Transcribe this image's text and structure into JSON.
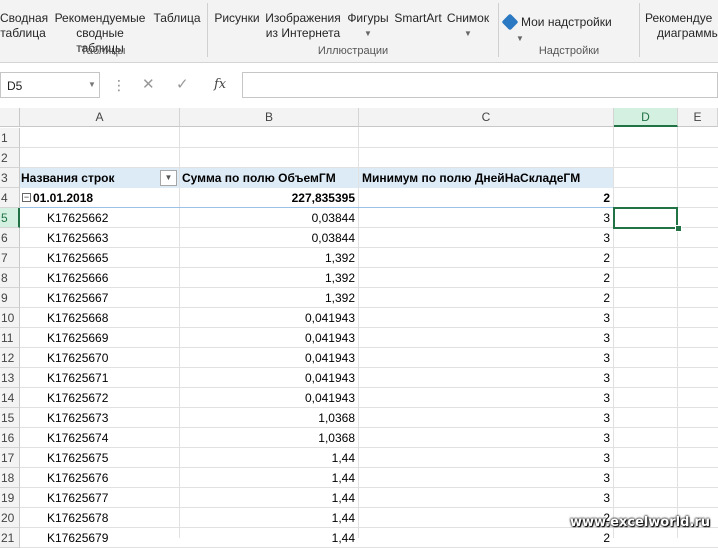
{
  "ribbon": {
    "groups": [
      {
        "label": "Таблицы",
        "buttons": [
          {
            "line1": "Сводная",
            "line2": "таблица"
          },
          {
            "line1": "Рекомендуемые",
            "line2": "сводные таблицы"
          },
          {
            "line1": "Таблица",
            "line2": ""
          }
        ]
      },
      {
        "label": "Иллюстрации",
        "buttons": [
          {
            "line1": "Рисунки",
            "line2": ""
          },
          {
            "line1": "Изображения",
            "line2": "из Интернета"
          },
          {
            "line1": "Фигуры",
            "line2": ""
          },
          {
            "line1": "SmartArt",
            "line2": ""
          },
          {
            "line1": "Снимок",
            "line2": ""
          }
        ]
      },
      {
        "label": "Надстройки",
        "buttons": [
          {
            "line1": "Мои надстройки",
            "line2": ""
          }
        ]
      },
      {
        "label": "",
        "buttons": [
          {
            "line1": "Рекомендуе",
            "line2": "диаграммы"
          }
        ]
      }
    ]
  },
  "formula_bar": {
    "name_box": "D5",
    "value": ""
  },
  "columns": [
    "A",
    "B",
    "C",
    "D",
    "E"
  ],
  "rows": [
    "1",
    "2",
    "3",
    "4",
    "5",
    "6",
    "7",
    "8",
    "9",
    "10",
    "11",
    "12",
    "13",
    "14",
    "15",
    "16",
    "17",
    "18",
    "19",
    "20",
    "21"
  ],
  "pivot": {
    "headers": [
      "Названия строк",
      "Сумма по полю ОбъемГМ",
      "Минимум по полю ДнейНаСкладеГМ"
    ],
    "group": {
      "label": "01.01.2018",
      "sum": "227,835395",
      "min": "2"
    },
    "items": [
      {
        "name": "K17625662",
        "sum": "0,03844",
        "min": "3"
      },
      {
        "name": "K17625663",
        "sum": "0,03844",
        "min": "3"
      },
      {
        "name": "K17625665",
        "sum": "1,392",
        "min": "2"
      },
      {
        "name": "K17625666",
        "sum": "1,392",
        "min": "2"
      },
      {
        "name": "K17625667",
        "sum": "1,392",
        "min": "2"
      },
      {
        "name": "K17625668",
        "sum": "0,041943",
        "min": "3"
      },
      {
        "name": "K17625669",
        "sum": "0,041943",
        "min": "3"
      },
      {
        "name": "K17625670",
        "sum": "0,041943",
        "min": "3"
      },
      {
        "name": "K17625671",
        "sum": "0,041943",
        "min": "3"
      },
      {
        "name": "K17625672",
        "sum": "0,041943",
        "min": "3"
      },
      {
        "name": "K17625673",
        "sum": "1,0368",
        "min": "3"
      },
      {
        "name": "K17625674",
        "sum": "1,0368",
        "min": "3"
      },
      {
        "name": "K17625675",
        "sum": "1,44",
        "min": "3"
      },
      {
        "name": "K17625676",
        "sum": "1,44",
        "min": "3"
      },
      {
        "name": "K17625677",
        "sum": "1,44",
        "min": "3"
      },
      {
        "name": "K17625678",
        "sum": "1,44",
        "min": "2"
      },
      {
        "name": "K17625679",
        "sum": "1,44",
        "min": "2"
      }
    ]
  },
  "watermark": "www.excelworld.ru",
  "colors": {
    "accent": "#217346",
    "pivot_header": "#ddebf7"
  }
}
